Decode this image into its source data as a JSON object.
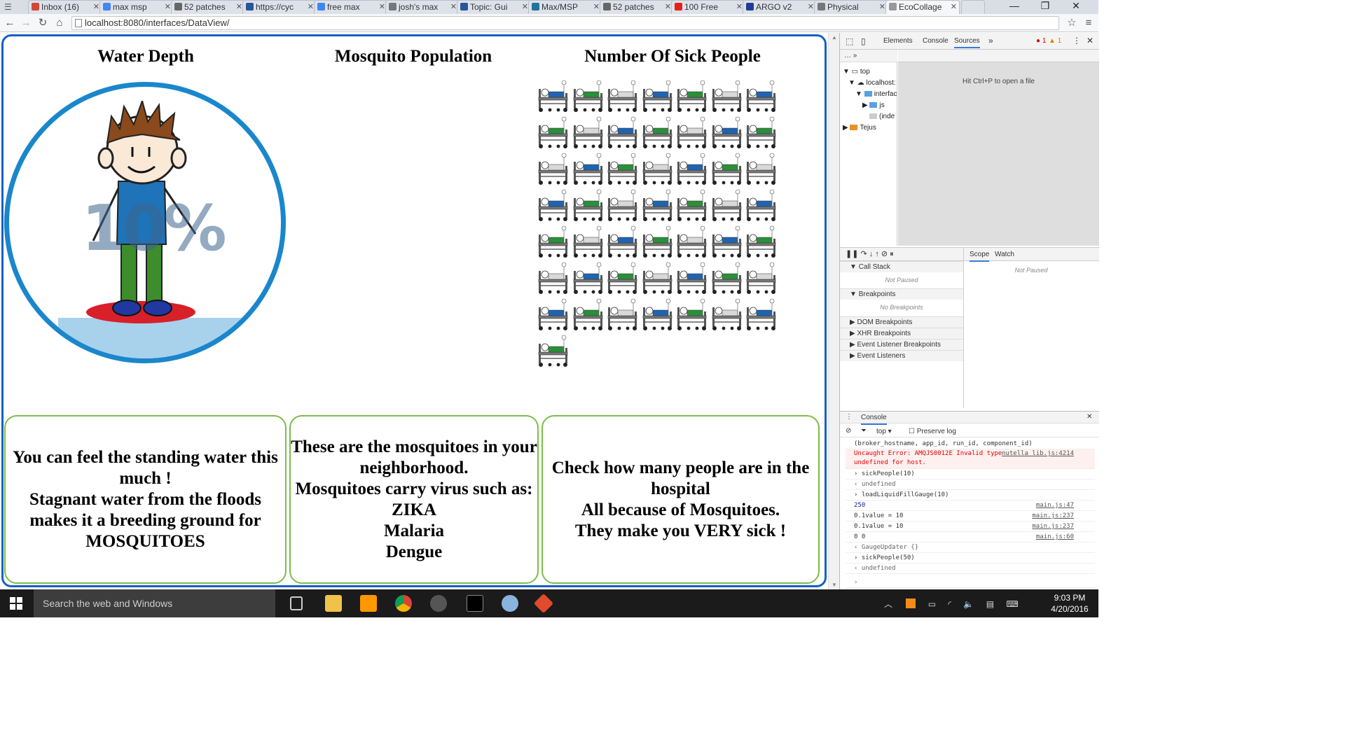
{
  "browser": {
    "tabs": [
      {
        "label": "Inbox (16)",
        "color": "#d44638"
      },
      {
        "label": "max msp",
        "color": "#4285f4"
      },
      {
        "label": "52 patches",
        "color": "#666666"
      },
      {
        "label": "https://cyc",
        "color": "#2a5599"
      },
      {
        "label": "free max",
        "color": "#4285f4"
      },
      {
        "label": "josh's max",
        "color": "#777777"
      },
      {
        "label": "Topic: Gui",
        "color": "#2a5599"
      },
      {
        "label": "Max/MSP",
        "color": "#21759b"
      },
      {
        "label": "52 patches",
        "color": "#666666"
      },
      {
        "label": "100 Free",
        "color": "#e62117"
      },
      {
        "label": "ARGO v2",
        "color": "#1c3f94"
      },
      {
        "label": "Physical",
        "color": "#777777"
      },
      {
        "label": "EcoCollage",
        "color": "#999999"
      }
    ],
    "address": "localhost:8080/interfaces/DataView/",
    "window_controls": {
      "minimize": "—",
      "maximize": "❐",
      "close": "✕"
    }
  },
  "page": {
    "headings": {
      "water": "Water Depth",
      "mosquito": "Mosquito Population",
      "sick": "Number Of Sick People"
    },
    "gauge": {
      "percent": "10%",
      "fill_fraction": 0.1,
      "ring_color": "#1a86cc",
      "water_color": "#a8d1ec"
    },
    "sick_count": 50,
    "cards": {
      "water": [
        "You can feel the standing water this much !",
        "Stagnant water from the floods makes it a breeding ground for MOSQUITOES"
      ],
      "mosquito": [
        "These are the mosquitoes in your neighborhood.",
        "Mosquitoes carry virus such as:",
        "ZIKA",
        "Malaria",
        "Dengue"
      ],
      "sick": [
        "Check how many people are in the hospital",
        "All because of Mosquitoes.",
        "They make you VERY sick !"
      ]
    },
    "frame_color": "#1560c5",
    "card_border_color": "#7cbd4a"
  },
  "devtools": {
    "tabs": [
      "Elements",
      "Console",
      "Sources"
    ],
    "active_tab": "Sources",
    "errors": "1",
    "warnings": "1",
    "tree": [
      "top",
      "localhost:",
      "interfac",
      "js",
      "(inde",
      "Tejus"
    ],
    "hint": "Hit Ctrl+P to open a file",
    "scope_tabs": [
      "Scope",
      "Watch"
    ],
    "not_paused": "Not Paused",
    "sections": {
      "call_stack": "Call Stack",
      "call_stack_status": "Not Paused",
      "breakpoints": "Breakpoints",
      "breakpoints_status": "No Breakpoints",
      "dom_breakpoints": "DOM Breakpoints",
      "xhr_breakpoints": "XHR Breakpoints",
      "event_listener_breakpoints": "Event Listener Breakpoints",
      "event_listeners": "Event Listeners"
    },
    "console": {
      "title": "Console",
      "context": "top",
      "preserve_log": "Preserve log",
      "lines": [
        {
          "text": "(broker_hostname, app_id, run_id, component_id)",
          "src": "",
          "kind": "plain"
        },
        {
          "text": "Uncaught Error: AMQJS0012E Invalid type undefined for host.",
          "src": "nutella_lib.js:4214",
          "kind": "error"
        },
        {
          "text": "sickPeople(10)",
          "src": "",
          "kind": "input"
        },
        {
          "text": "undefined",
          "src": "",
          "kind": "result"
        },
        {
          "text": "loadLiquidFillGauge(10)",
          "src": "",
          "kind": "input"
        },
        {
          "text": "250",
          "src": "main.js:47",
          "kind": "num"
        },
        {
          "text": "0.1value = 10",
          "src": "main.js:237",
          "kind": "plain"
        },
        {
          "text": "0.1value = 10",
          "src": "main.js:237",
          "kind": "plain"
        },
        {
          "text": "0 0",
          "src": "main.js:60",
          "kind": "plain"
        },
        {
          "text": "GaugeUpdater {}",
          "src": "",
          "kind": "result"
        },
        {
          "text": "sickPeople(50)",
          "src": "",
          "kind": "input"
        },
        {
          "text": "undefined",
          "src": "",
          "kind": "result"
        }
      ]
    }
  },
  "taskbar": {
    "search_placeholder": "Search the web and Windows",
    "time": "9:03 PM",
    "date": "4/20/2016"
  }
}
